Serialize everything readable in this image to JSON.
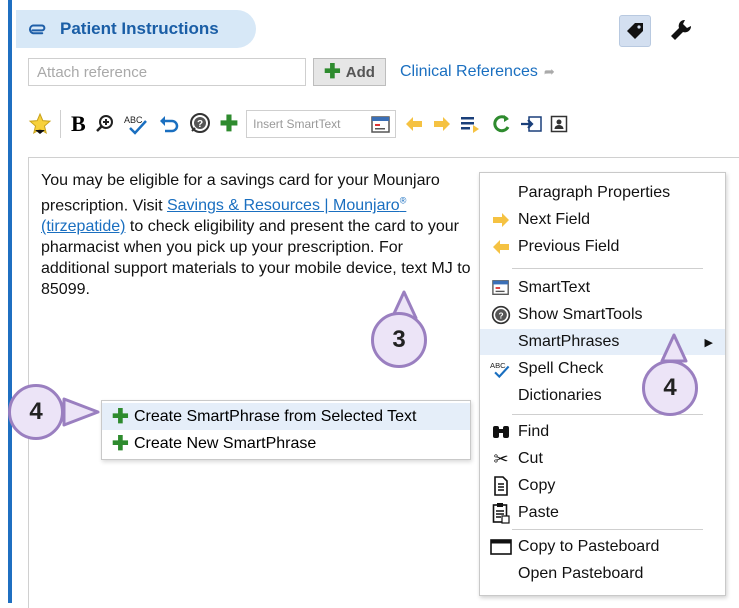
{
  "header": {
    "title": "Patient Instructions"
  },
  "reference": {
    "placeholder": "Attach reference",
    "add_label": "Add",
    "clinical_references": "Clinical References"
  },
  "toolbar": {
    "insert_smarttext_placeholder": "Insert SmartText"
  },
  "editor": {
    "text_before_link": "You may be eligible for a savings card for your Mounjaro prescription. Visit ",
    "link_text_1": "Savings & Resources | Mounjaro",
    "link_sup": "®",
    "link_text_2": " (tirzepatide)",
    "text_after_link": " to check eligibility and present the card to your pharmacist when you pick up your prescription. For additional support materials to your mobile device, text MJ to 85099."
  },
  "context_menu": {
    "items": [
      {
        "label": "Paragraph Properties",
        "icon": "none"
      },
      {
        "label": "Next Field",
        "icon": "arrow-right-icon"
      },
      {
        "label": "Previous Field",
        "icon": "arrow-left-icon"
      },
      {
        "label": "SmartText",
        "icon": "smarttext-icon"
      },
      {
        "label": "Show SmartTools",
        "icon": "question-circle-icon"
      },
      {
        "label": "SmartPhrases",
        "icon": "none",
        "submenu": true
      },
      {
        "label": "Spell Check",
        "icon": "spellcheck-icon"
      },
      {
        "label": "Dictionaries",
        "icon": "none"
      },
      {
        "label": "Find",
        "icon": "binoculars-icon"
      },
      {
        "label": "Cut",
        "icon": "scissors-icon"
      },
      {
        "label": "Copy",
        "icon": "copy-icon"
      },
      {
        "label": "Paste",
        "icon": "paste-icon"
      },
      {
        "label": "Copy to Pasteboard",
        "icon": "window-icon"
      },
      {
        "label": "Open Pasteboard",
        "icon": "none"
      }
    ]
  },
  "smartphrase_submenu": {
    "items": [
      {
        "label": "Create SmartPhrase from Selected Text"
      },
      {
        "label": "Create New SmartPhrase"
      }
    ]
  },
  "callouts": {
    "editor_step": "3",
    "menu_step": "4",
    "submenu_step": "4"
  },
  "colors": {
    "accent": "#1a6fc0",
    "header_bg": "#d7e8f7",
    "callout_fill": "#ece4f7",
    "callout_border": "#9a7fc0",
    "add_green": "#2e8b2e",
    "arrow_yellow": "#f5c242"
  }
}
